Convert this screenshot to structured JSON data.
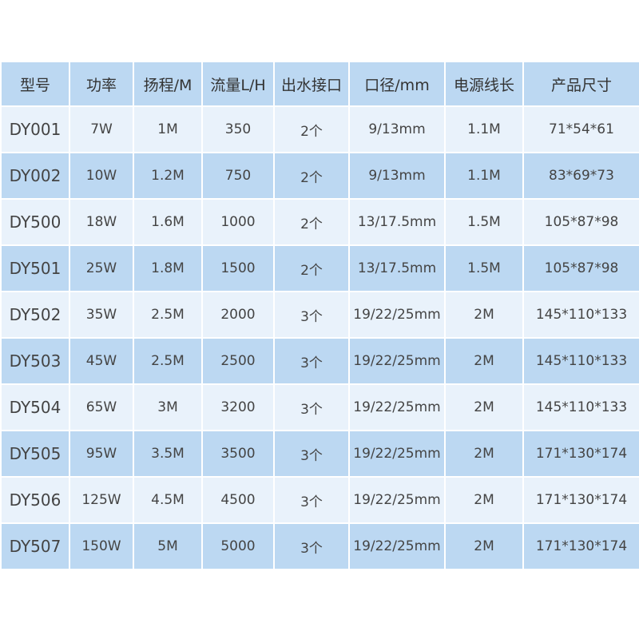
{
  "table": {
    "headers": [
      "型号",
      "功率",
      "扬程/M",
      "流量L/H",
      "出水接口",
      "口径/mm",
      "电源线长",
      "产品尺寸"
    ],
    "rows": [
      [
        "DY001",
        "7W",
        "1M",
        "350",
        "2个",
        "9/13mm",
        "1.1M",
        "71*54*61"
      ],
      [
        "DY002",
        "10W",
        "1.2M",
        "750",
        "2个",
        "9/13mm",
        "1.1M",
        "83*69*73"
      ],
      [
        "DY500",
        "18W",
        "1.6M",
        "1000",
        "2个",
        "13/17.5mm",
        "1.5M",
        "105*87*98"
      ],
      [
        "DY501",
        "25W",
        "1.8M",
        "1500",
        "2个",
        "13/17.5mm",
        "1.5M",
        "105*87*98"
      ],
      [
        "DY502",
        "35W",
        "2.5M",
        "2000",
        "3个",
        "19/22/25mm",
        "2M",
        "145*110*133"
      ],
      [
        "DY503",
        "45W",
        "2.5M",
        "2500",
        "3个",
        "19/22/25mm",
        "2M",
        "145*110*133"
      ],
      [
        "DY504",
        "65W",
        "3M",
        "3200",
        "3个",
        "19/22/25mm",
        "2M",
        "145*110*133"
      ],
      [
        "DY505",
        "95W",
        "3.5M",
        "3500",
        "3个",
        "19/22/25mm",
        "2M",
        "171*130*174"
      ],
      [
        "DY506",
        "125W",
        "4.5M",
        "4500",
        "3个",
        "19/22/25mm",
        "2M",
        "171*130*174"
      ],
      [
        "DY507",
        "150W",
        "5M",
        "5000",
        "3个",
        "19/22/25mm",
        "2M",
        "171*130*174"
      ]
    ]
  },
  "colors": {
    "header_bg": "#bcd8f2",
    "row_light": "#e9f2fb",
    "row_dark": "#bcd8f2"
  }
}
